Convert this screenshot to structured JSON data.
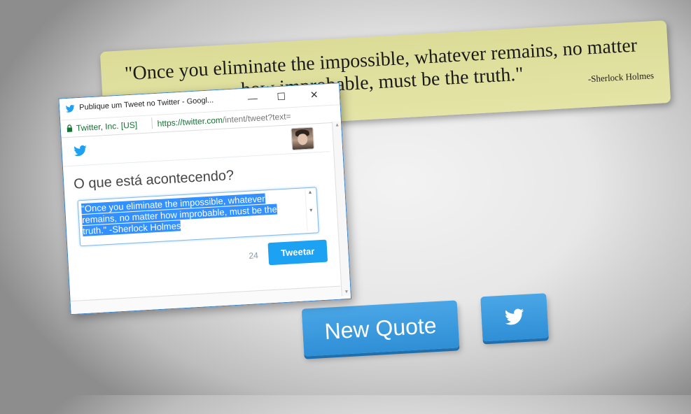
{
  "quote": {
    "text": "\"Once you eliminate the impossible, whatever remains, no matter how improbable, must be the truth.\"",
    "author": "-Sherlock Holmes"
  },
  "buttons": {
    "new_quote_label": "New Quote",
    "tweet_icon": "twitter-bird-icon"
  },
  "popup": {
    "window_title": "Publique um Tweet no Twitter - Googl...",
    "controls": {
      "minimize": "—",
      "maximize": "☐",
      "close": "✕"
    },
    "site_badge": "Twitter, Inc. [US]",
    "url_secure": "https://twitter.com",
    "url_rest": "/intent/tweet?text=",
    "heading": "O que está acontecendo?",
    "tweet_text": "\"Once you eliminate the impossible, whatever remains, no matter how improbable, must be the truth.\" -Sherlock Holmes",
    "char_count": "24",
    "tweet_button": "Tweetar"
  },
  "colors": {
    "quote_card": "#e0e0a0",
    "button_blue": "#3b9ae0",
    "twitter_blue": "#1da1f2",
    "selection": "#3390ff"
  }
}
